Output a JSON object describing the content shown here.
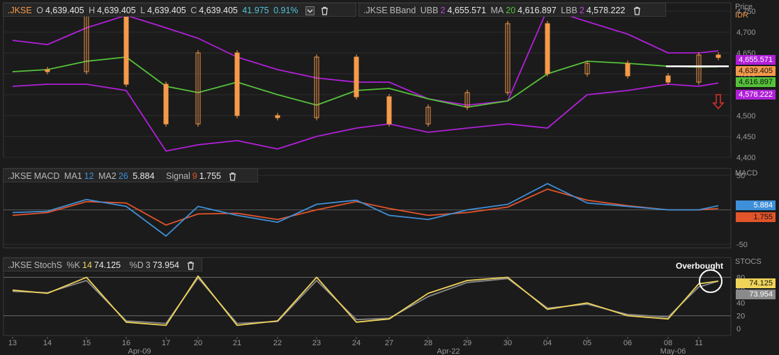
{
  "colors": {
    "bg": "#1b1b1b",
    "grid": "#2e2e2e",
    "axis_text": "#9a9a9a",
    "candle": "#f59a4a",
    "bb_band": "#b020d8",
    "bb_ma": "#55c23a",
    "macd": "#3f8fd8",
    "signal": "#e2542a",
    "stoch_k": "#f0d45a",
    "stoch_d": "#8a8a8a",
    "accent": "#4ec4d8",
    "tag_ubb": "#b020d8",
    "tag_lbb": "#b020d8",
    "tag_close": "#f59a4a",
    "tag_ma": "#55c23a",
    "tag_macd": "#3f8fd8",
    "tag_signal": "#e2542a",
    "tag_k": "#f0d45a",
    "tag_d": "#8a8a8a",
    "arrow": "#e03030"
  },
  "price_header": {
    "symbol": ".JKSE",
    "o_label": "O",
    "open": "4,639.405",
    "h_label": "H",
    "high": "4,639.405",
    "l_label": "L",
    "low": "4,639.405",
    "c_label": "C",
    "close": "4,639.405",
    "change": "41.975",
    "change_pct": "0.91%",
    "dropdown_icon": "chevron-down-icon",
    "delete_icon": "trash-icon"
  },
  "bband_header": {
    "symbol": ".JKSE",
    "name": "BBand",
    "ubb_label": "UBB",
    "ubb_period": "2",
    "ubb": "4,655.571",
    "ma_label": "MA",
    "ma_period": "20",
    "ma": "4,616.897",
    "lbb_label": "LBB",
    "lbb_period": "2",
    "lbb": "4,578.222",
    "delete_icon": "trash-icon"
  },
  "macd_header": {
    "symbol": ".JKSE",
    "name": "MACD",
    "ma1_label": "MA1",
    "ma1": "12",
    "ma2_label": "MA2",
    "ma2": "26",
    "value": "5.884",
    "signal_label": "Signal",
    "signal_period": "9",
    "signal": "1.755",
    "delete_icon": "trash-icon"
  },
  "stoch_header": {
    "symbol": ".JKSE",
    "name": "StochS",
    "k_label": "%K",
    "k_period": "14",
    "k": "74.125",
    "d_label": "%D",
    "d_period": "3",
    "d": "73.954",
    "delete_icon": "trash-icon"
  },
  "axis": {
    "price_title": "Price",
    "price_unit": "IDR",
    "price_ticks": [
      "4,750",
      "4,700",
      "4,650",
      "4,600",
      "4,550",
      "4,500",
      "4,450",
      "4,400"
    ],
    "macd_title": "MACD",
    "macd_ticks": [
      "50",
      "-50"
    ],
    "stoch_title": "STOCS",
    "stoch_ticks": [
      "80",
      "60",
      "40",
      "20",
      "0"
    ],
    "day_labels": [
      "13",
      "14",
      "15",
      "16",
      "17",
      "20",
      "21",
      "22",
      "23",
      "24",
      "27",
      "28",
      "29",
      "30",
      "04",
      "05",
      "06",
      "08",
      "11"
    ],
    "month_labels": [
      "Apr-09",
      "Apr-22",
      "May-06"
    ]
  },
  "tags": {
    "ubb": "4,655.571",
    "close": "4,639.405",
    "ma": "4,616.897",
    "lbb": "4,578.222",
    "macd": "5.884",
    "signal": "1.755",
    "k": "74.125",
    "d": "73.954"
  },
  "annotation": {
    "text": "Overbought"
  },
  "chart_data": [
    {
      "type": "line",
      "pane": "price",
      "ylim": [
        4400,
        4770
      ],
      "x": [
        "13",
        "14",
        "15",
        "16",
        "17",
        "20",
        "21",
        "22",
        "23",
        "24",
        "27",
        "28",
        "29",
        "30",
        "04",
        "05",
        "06",
        "08",
        "11",
        "11+"
      ],
      "series": [
        {
          "name": "UBB",
          "values": [
            4680,
            4670,
            4710,
            4740,
            4710,
            4685,
            4640,
            4610,
            4590,
            4580,
            4580,
            4540,
            4525,
            4535,
            4755,
            4725,
            4695,
            4650,
            4650,
            4655
          ]
        },
        {
          "name": "MA",
          "values": [
            4605,
            4610,
            4630,
            4640,
            4570,
            4555,
            4580,
            4550,
            4525,
            4560,
            4565,
            4540,
            4520,
            4535,
            4600,
            4630,
            4625,
            4618,
            4616,
            4617
          ]
        },
        {
          "name": "LBB",
          "values": [
            4570,
            4575,
            4575,
            4560,
            4415,
            4430,
            4440,
            4420,
            4450,
            4470,
            4480,
            4460,
            4470,
            4480,
            4470,
            4550,
            4560,
            4575,
            4570,
            4578
          ]
        },
        {
          "name": "Close",
          "values": [
            4610,
            4605,
            4740,
            4575,
            4480,
            4650,
            4500,
            4495,
            4640,
            4545,
            4480,
            4520,
            4555,
            4720,
            4600,
            4625,
            4595,
            4580,
            4645,
            4639
          ]
        }
      ]
    },
    {
      "type": "line",
      "pane": "macd",
      "ylim": [
        -55,
        60
      ],
      "x": [
        "13",
        "14",
        "15",
        "16",
        "17",
        "20",
        "21",
        "22",
        "23",
        "24",
        "27",
        "28",
        "29",
        "30",
        "04",
        "05",
        "06",
        "08",
        "11",
        "11+"
      ],
      "series": [
        {
          "name": "MACD",
          "values": [
            -4,
            -2,
            15,
            5,
            -38,
            5,
            -8,
            -18,
            8,
            14,
            -8,
            -14,
            0,
            8,
            38,
            10,
            5,
            0,
            0,
            6
          ]
        },
        {
          "name": "Signal",
          "values": [
            -8,
            -4,
            12,
            10,
            -22,
            -6,
            -5,
            -14,
            0,
            12,
            2,
            -8,
            -4,
            4,
            30,
            14,
            6,
            0,
            0,
            2
          ]
        }
      ]
    },
    {
      "type": "line",
      "pane": "stochastic",
      "ylim": [
        0,
        100
      ],
      "x": [
        "13",
        "14",
        "15",
        "16",
        "17",
        "20",
        "21",
        "22",
        "23",
        "24",
        "27",
        "28",
        "29",
        "30",
        "04",
        "05",
        "06",
        "08",
        "11",
        "11+"
      ],
      "series": [
        {
          "name": "%K",
          "values": [
            60,
            55,
            80,
            10,
            5,
            82,
            5,
            12,
            80,
            10,
            15,
            55,
            75,
            80,
            30,
            40,
            20,
            15,
            70,
            74
          ]
        },
        {
          "name": "%D",
          "values": [
            58,
            56,
            75,
            12,
            8,
            79,
            8,
            11,
            75,
            14,
            16,
            50,
            72,
            78,
            32,
            38,
            22,
            18,
            65,
            74
          ]
        }
      ]
    }
  ]
}
